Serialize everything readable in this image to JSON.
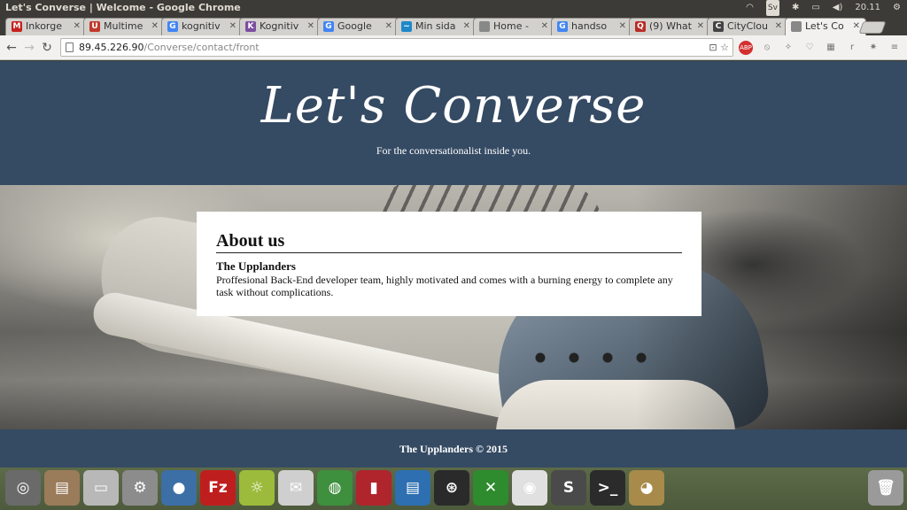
{
  "window": {
    "title": "Let's Converse | Welcome - Google Chrome"
  },
  "system_tray": {
    "keyboard_layout": "Sv",
    "clock": "20.11"
  },
  "tabs": [
    {
      "label": "Inkorge",
      "icon": "gmail-icon",
      "color": "#c5221f",
      "glyph": "M"
    },
    {
      "label": "Multime",
      "icon": "ut-logo-icon",
      "color": "#c0392b",
      "glyph": "U"
    },
    {
      "label": "kognitiv",
      "icon": "google-icon",
      "color": "#4285f4",
      "glyph": "G"
    },
    {
      "label": "Kognitiv",
      "icon": "course-icon",
      "color": "#7b4fa0",
      "glyph": "K"
    },
    {
      "label": "Google",
      "icon": "google-docs-icon",
      "color": "#4285f4",
      "glyph": "G"
    },
    {
      "label": "Min sida",
      "icon": "bank-icon",
      "color": "#1e88c8",
      "glyph": "~"
    },
    {
      "label": "Home -",
      "icon": "page-icon",
      "color": "#888888",
      "glyph": ""
    },
    {
      "label": "handso",
      "icon": "google-icon",
      "color": "#4285f4",
      "glyph": "G"
    },
    {
      "label": "(9) What",
      "icon": "quora-icon",
      "color": "#b92b27",
      "glyph": "Q"
    },
    {
      "label": "CityClou",
      "icon": "cityclou-icon",
      "color": "#444444",
      "glyph": "C"
    },
    {
      "label": "Let's Co",
      "icon": "page-icon",
      "color": "#888888",
      "glyph": "",
      "active": true
    }
  ],
  "toolbar": {
    "url_host": "89.45.226.90",
    "url_path": "/Converse/contact/front"
  },
  "site": {
    "title": "Let's Converse",
    "tagline": "For the conversationalist inside you.",
    "about": {
      "heading": "About us",
      "team_name": "The Upplanders",
      "description": "Proffesional Back-End developer team, highly motivated and comes with a burning energy to complete any task without complications."
    },
    "footer": "The Upplanders © 2015"
  },
  "dock": [
    {
      "name": "ubuntu-dash-icon",
      "bg": "#6a6a6a",
      "glyph": "◎"
    },
    {
      "name": "files-icon",
      "bg": "#9a7b5a",
      "glyph": "▤"
    },
    {
      "name": "drive-icon",
      "bg": "#b8b8b8",
      "glyph": "▭"
    },
    {
      "name": "system-settings-icon",
      "bg": "#8c8c8c",
      "glyph": "⚙"
    },
    {
      "name": "drop-icon",
      "bg": "#3c6fa6",
      "glyph": "●"
    },
    {
      "name": "filezilla-icon",
      "bg": "#bf1e1e",
      "glyph": "Fz"
    },
    {
      "name": "brightness-icon",
      "bg": "#9cbb3c",
      "glyph": "☼"
    },
    {
      "name": "mail-icon",
      "bg": "#cfcfcf",
      "glyph": "✉"
    },
    {
      "name": "globe-icon",
      "bg": "#3e8f3e",
      "glyph": "◍"
    },
    {
      "name": "book-icon",
      "bg": "#b0242b",
      "glyph": "▮"
    },
    {
      "name": "writer-icon",
      "bg": "#2d6fb0",
      "glyph": "▤"
    },
    {
      "name": "steam-icon",
      "bg": "#2a2a2a",
      "glyph": "⊛"
    },
    {
      "name": "spreadsheet-icon",
      "bg": "#2e8b2e",
      "glyph": "✕"
    },
    {
      "name": "chrome-icon",
      "bg": "#e0e0e0",
      "glyph": "◉"
    },
    {
      "name": "sublime-icon",
      "bg": "#4a4a4a",
      "glyph": "S"
    },
    {
      "name": "terminal-icon",
      "bg": "#2b2b2b",
      "glyph": ">_"
    },
    {
      "name": "gimp-icon",
      "bg": "#a88a4a",
      "glyph": "◕"
    },
    {
      "name": "trash-icon",
      "bg": "#9a9a9a",
      "glyph": "🗑"
    }
  ]
}
